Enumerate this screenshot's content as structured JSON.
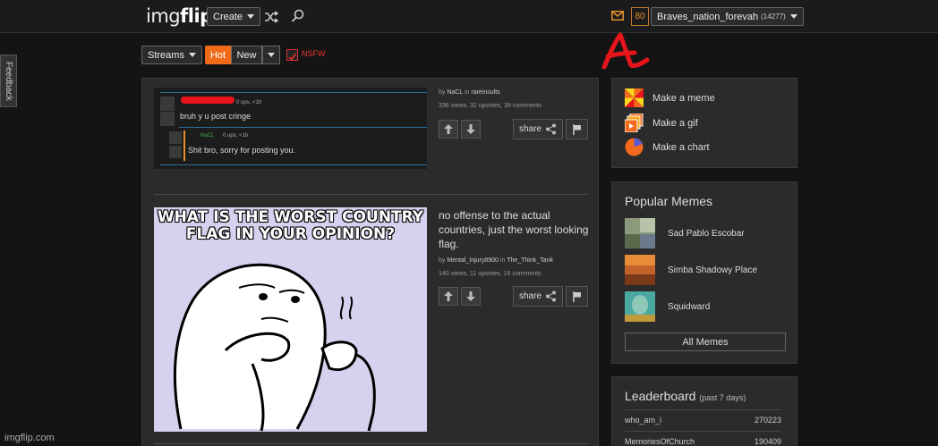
{
  "header": {
    "logo_left": "img",
    "logo_right": "flip",
    "create_label": "Create",
    "notification_count": "80",
    "username": "Braves_nation_forevah",
    "user_score": "(14277)"
  },
  "feedback_label": "Feedback",
  "filters": {
    "streams_label": "Streams",
    "hot_label": "Hot",
    "new_label": "New",
    "nsfw_label": "NSFW"
  },
  "annotation_letter": "A",
  "posts": [
    {
      "comments": [
        {
          "meta": "0 ups, <1h",
          "text": "bruh y u post cringe"
        },
        {
          "user": "NaCL",
          "meta": "0 ups, <1h",
          "text": "Shit bro, sorry for posting you."
        }
      ],
      "by": "by",
      "author": "NaCL",
      "in": "in",
      "stream": "rareinsults",
      "stats": "336 views, 32 upvotes, 39 comments",
      "share_label": "share"
    },
    {
      "image_text": "WHAT IS THE WORST COUNTRY FLAG IN YOUR OPINION?",
      "title": "no offense to the actual countries, just the worst looking flag.",
      "by": "by",
      "author": "Mental_Injury8900",
      "in": "in",
      "stream": "The_Think_Tank",
      "stats": "140 views, 11 upvotes, 16 comments",
      "share_label": "share"
    }
  ],
  "sidebar": {
    "make_items": [
      "Make a meme",
      "Make a gif",
      "Make a chart"
    ],
    "popular_title": "Popular Memes",
    "popular_memes": [
      "Sad Pablo Escobar",
      "Simba Shadowy Place",
      "Squidward"
    ],
    "all_memes_label": "All Memes",
    "leaderboard_title": "Leaderboard",
    "leaderboard_period": "(past 7 days)",
    "leaderboard": [
      {
        "user": "who_am_i",
        "score": "270223"
      },
      {
        "user": "MemoriesOfChurch",
        "score": "190409"
      }
    ]
  },
  "watermark": "imgflip.com",
  "colors": {
    "accent": "#f06a19",
    "background": "#141414",
    "panel": "#2b2b2b"
  }
}
